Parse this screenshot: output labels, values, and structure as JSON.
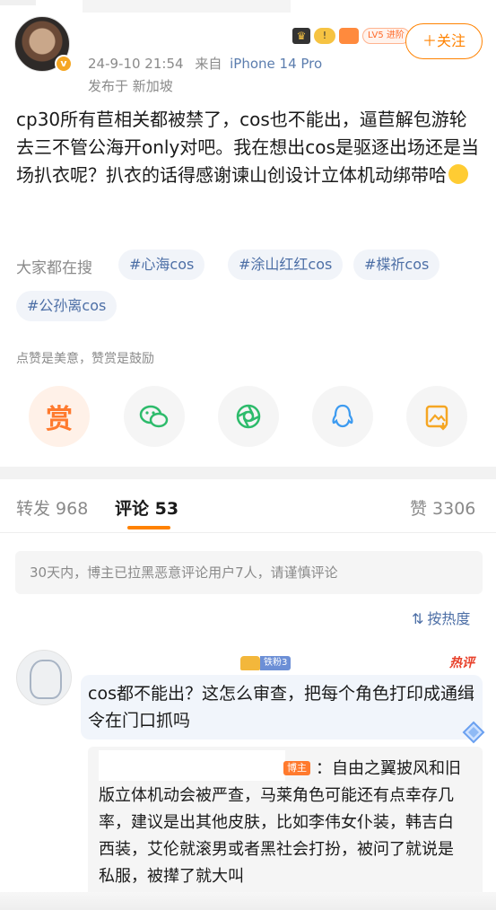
{
  "post": {
    "timestamp": "24-9-10 21:54",
    "from_label": "来自",
    "device": "iPhone 14 Pro",
    "location": "发布于 新加坡",
    "follow_label": "关注",
    "level_badge": "LV5 进阶",
    "text": "cp30所有苣相关都被禁了，cos也不能出，逼苣解包游轮去三不管公海开only对吧。我在想出cos是驱逐出场还是当场扒衣呢？扒衣的话得感谢谏山创设计立体机动绑带哈"
  },
  "search": {
    "label": "大家都在搜",
    "chips": [
      "#心海cos",
      "#涂山红红cos",
      "#楪祈cos",
      "#公孙离cos"
    ]
  },
  "reward": {
    "hint": "点赞是美意，赞赏是鼓励",
    "reward_glyph": "赏"
  },
  "actions": [
    "reward",
    "wechat",
    "moments",
    "qq",
    "save-image"
  ],
  "tabs": {
    "repost": "转发 968",
    "comments": "评论 53",
    "likes": "赞 3306"
  },
  "notice": "30天内，博主已拉黑恶意评论用户7人，请谨慎评论",
  "sort_label": "按热度",
  "comment": {
    "fan_badge": "铁粉3",
    "hot_tag": "热评",
    "text": "cos都不能出？这怎么审查，把每个角色打印成通缉令在门口抓吗",
    "reply": {
      "blogger_tag": "博主",
      "text": "：自由之翼披风和旧版立体机动会被严查，马莱角色可能还有点幸存几率，建议是出其他皮肤，比如李伟女仆装，韩吉白西装，艾伦就滚男或者黑社会打扮，被问了就说是私服，被撵了就大叫"
    }
  },
  "colors": {
    "accent": "#ff8200",
    "link": "#4d6fa6",
    "hot": "#e8412b"
  }
}
